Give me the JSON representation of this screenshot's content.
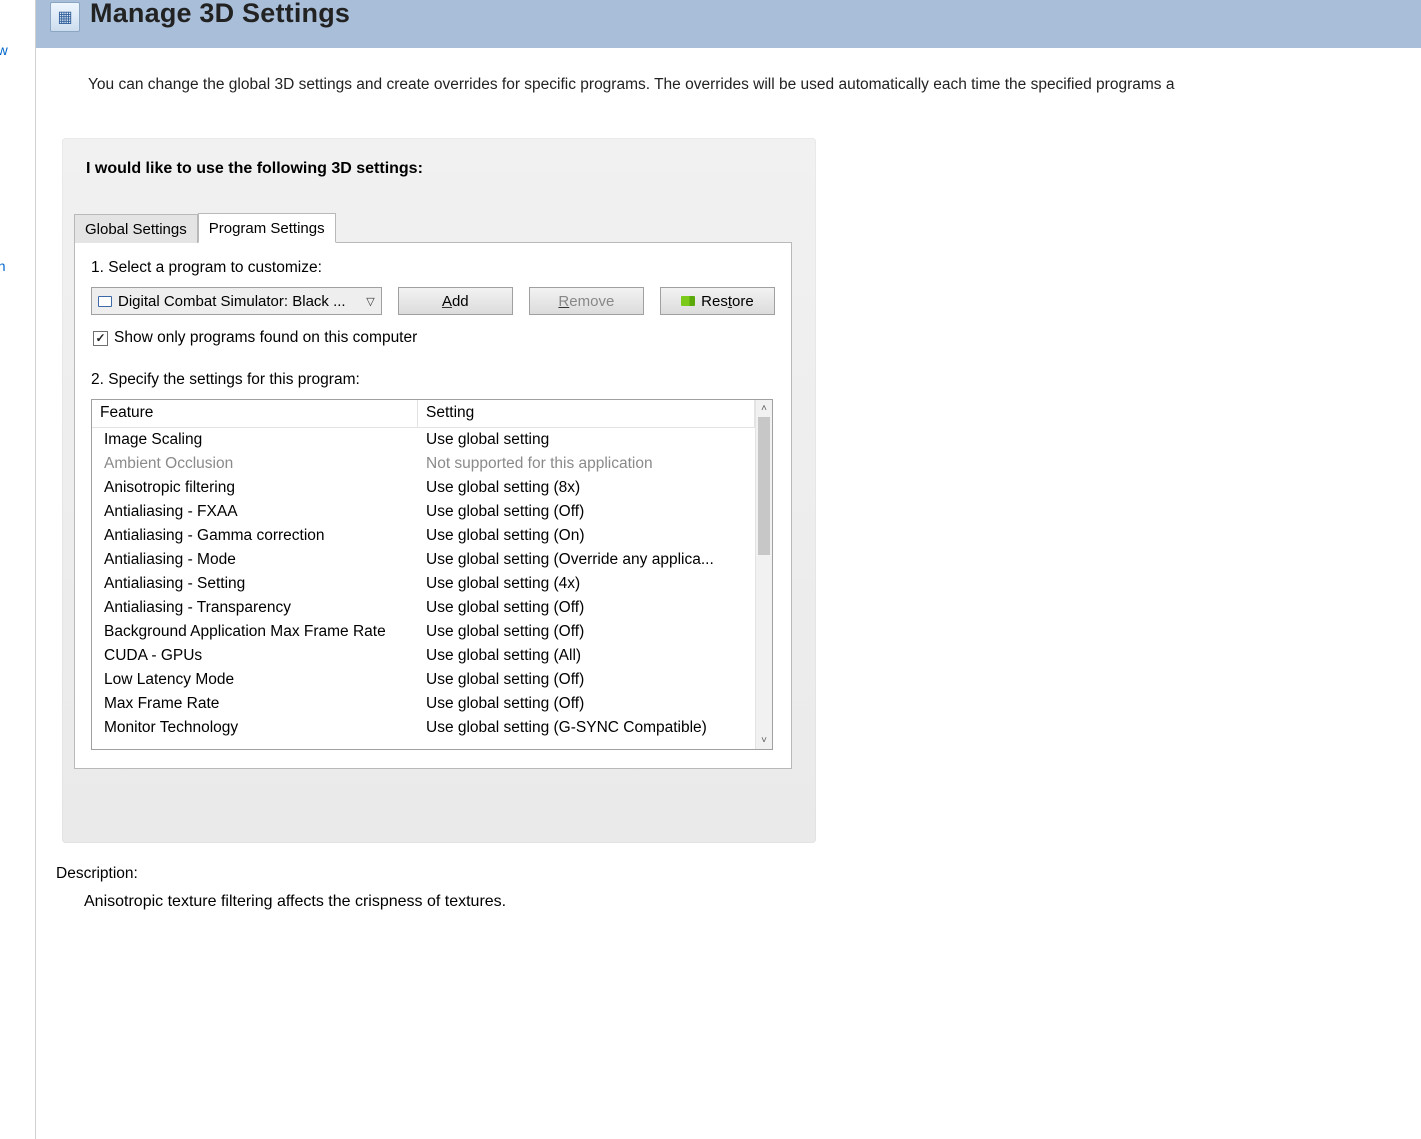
{
  "sidebar": {
    "frag1": "eview",
    "frag2": "on"
  },
  "header": {
    "title": "Manage 3D Settings",
    "icon_glyph": "▦"
  },
  "intro": "You can change the global 3D settings and create overrides for specific programs. The overrides will be used automatically each time the specified programs a",
  "group": {
    "title": "I would like to use the following 3D settings:"
  },
  "tabs": {
    "global": "Global Settings",
    "program": "Program Settings"
  },
  "step1": {
    "label": "1. Select a program to customize:",
    "selected": "Digital Combat Simulator: Black ...",
    "add": "dd",
    "add_prefix": "A",
    "remove": "emove",
    "remove_prefix": "R",
    "restore": "tore",
    "restore_prefix": "Res",
    "checkbox": "Show only programs found on this computer"
  },
  "step2": {
    "label": "2. Specify the settings for this program:",
    "headers": {
      "feature": "Feature",
      "setting": "Setting"
    },
    "rows": [
      {
        "feature": "Image Scaling",
        "setting": "Use global setting",
        "disabled": false
      },
      {
        "feature": "Ambient Occlusion",
        "setting": "Not supported for this application",
        "disabled": true
      },
      {
        "feature": "Anisotropic filtering",
        "setting": "Use global setting (8x)",
        "disabled": false
      },
      {
        "feature": "Antialiasing - FXAA",
        "setting": "Use global setting (Off)",
        "disabled": false
      },
      {
        "feature": "Antialiasing - Gamma correction",
        "setting": "Use global setting (On)",
        "disabled": false
      },
      {
        "feature": "Antialiasing - Mode",
        "setting": "Use global setting (Override any applica...",
        "disabled": false
      },
      {
        "feature": "Antialiasing - Setting",
        "setting": "Use global setting (4x)",
        "disabled": false
      },
      {
        "feature": "Antialiasing - Transparency",
        "setting": "Use global setting (Off)",
        "disabled": false
      },
      {
        "feature": "Background Application Max Frame Rate",
        "setting": "Use global setting (Off)",
        "disabled": false
      },
      {
        "feature": "CUDA - GPUs",
        "setting": "Use global setting (All)",
        "disabled": false
      },
      {
        "feature": "Low Latency Mode",
        "setting": "Use global setting (Off)",
        "disabled": false
      },
      {
        "feature": "Max Frame Rate",
        "setting": "Use global setting (Off)",
        "disabled": false
      },
      {
        "feature": "Monitor Technology",
        "setting": "Use global setting (G-SYNC Compatible)",
        "disabled": false
      }
    ]
  },
  "description": {
    "label": "Description:",
    "text": "Anisotropic texture filtering affects the crispness of textures."
  }
}
